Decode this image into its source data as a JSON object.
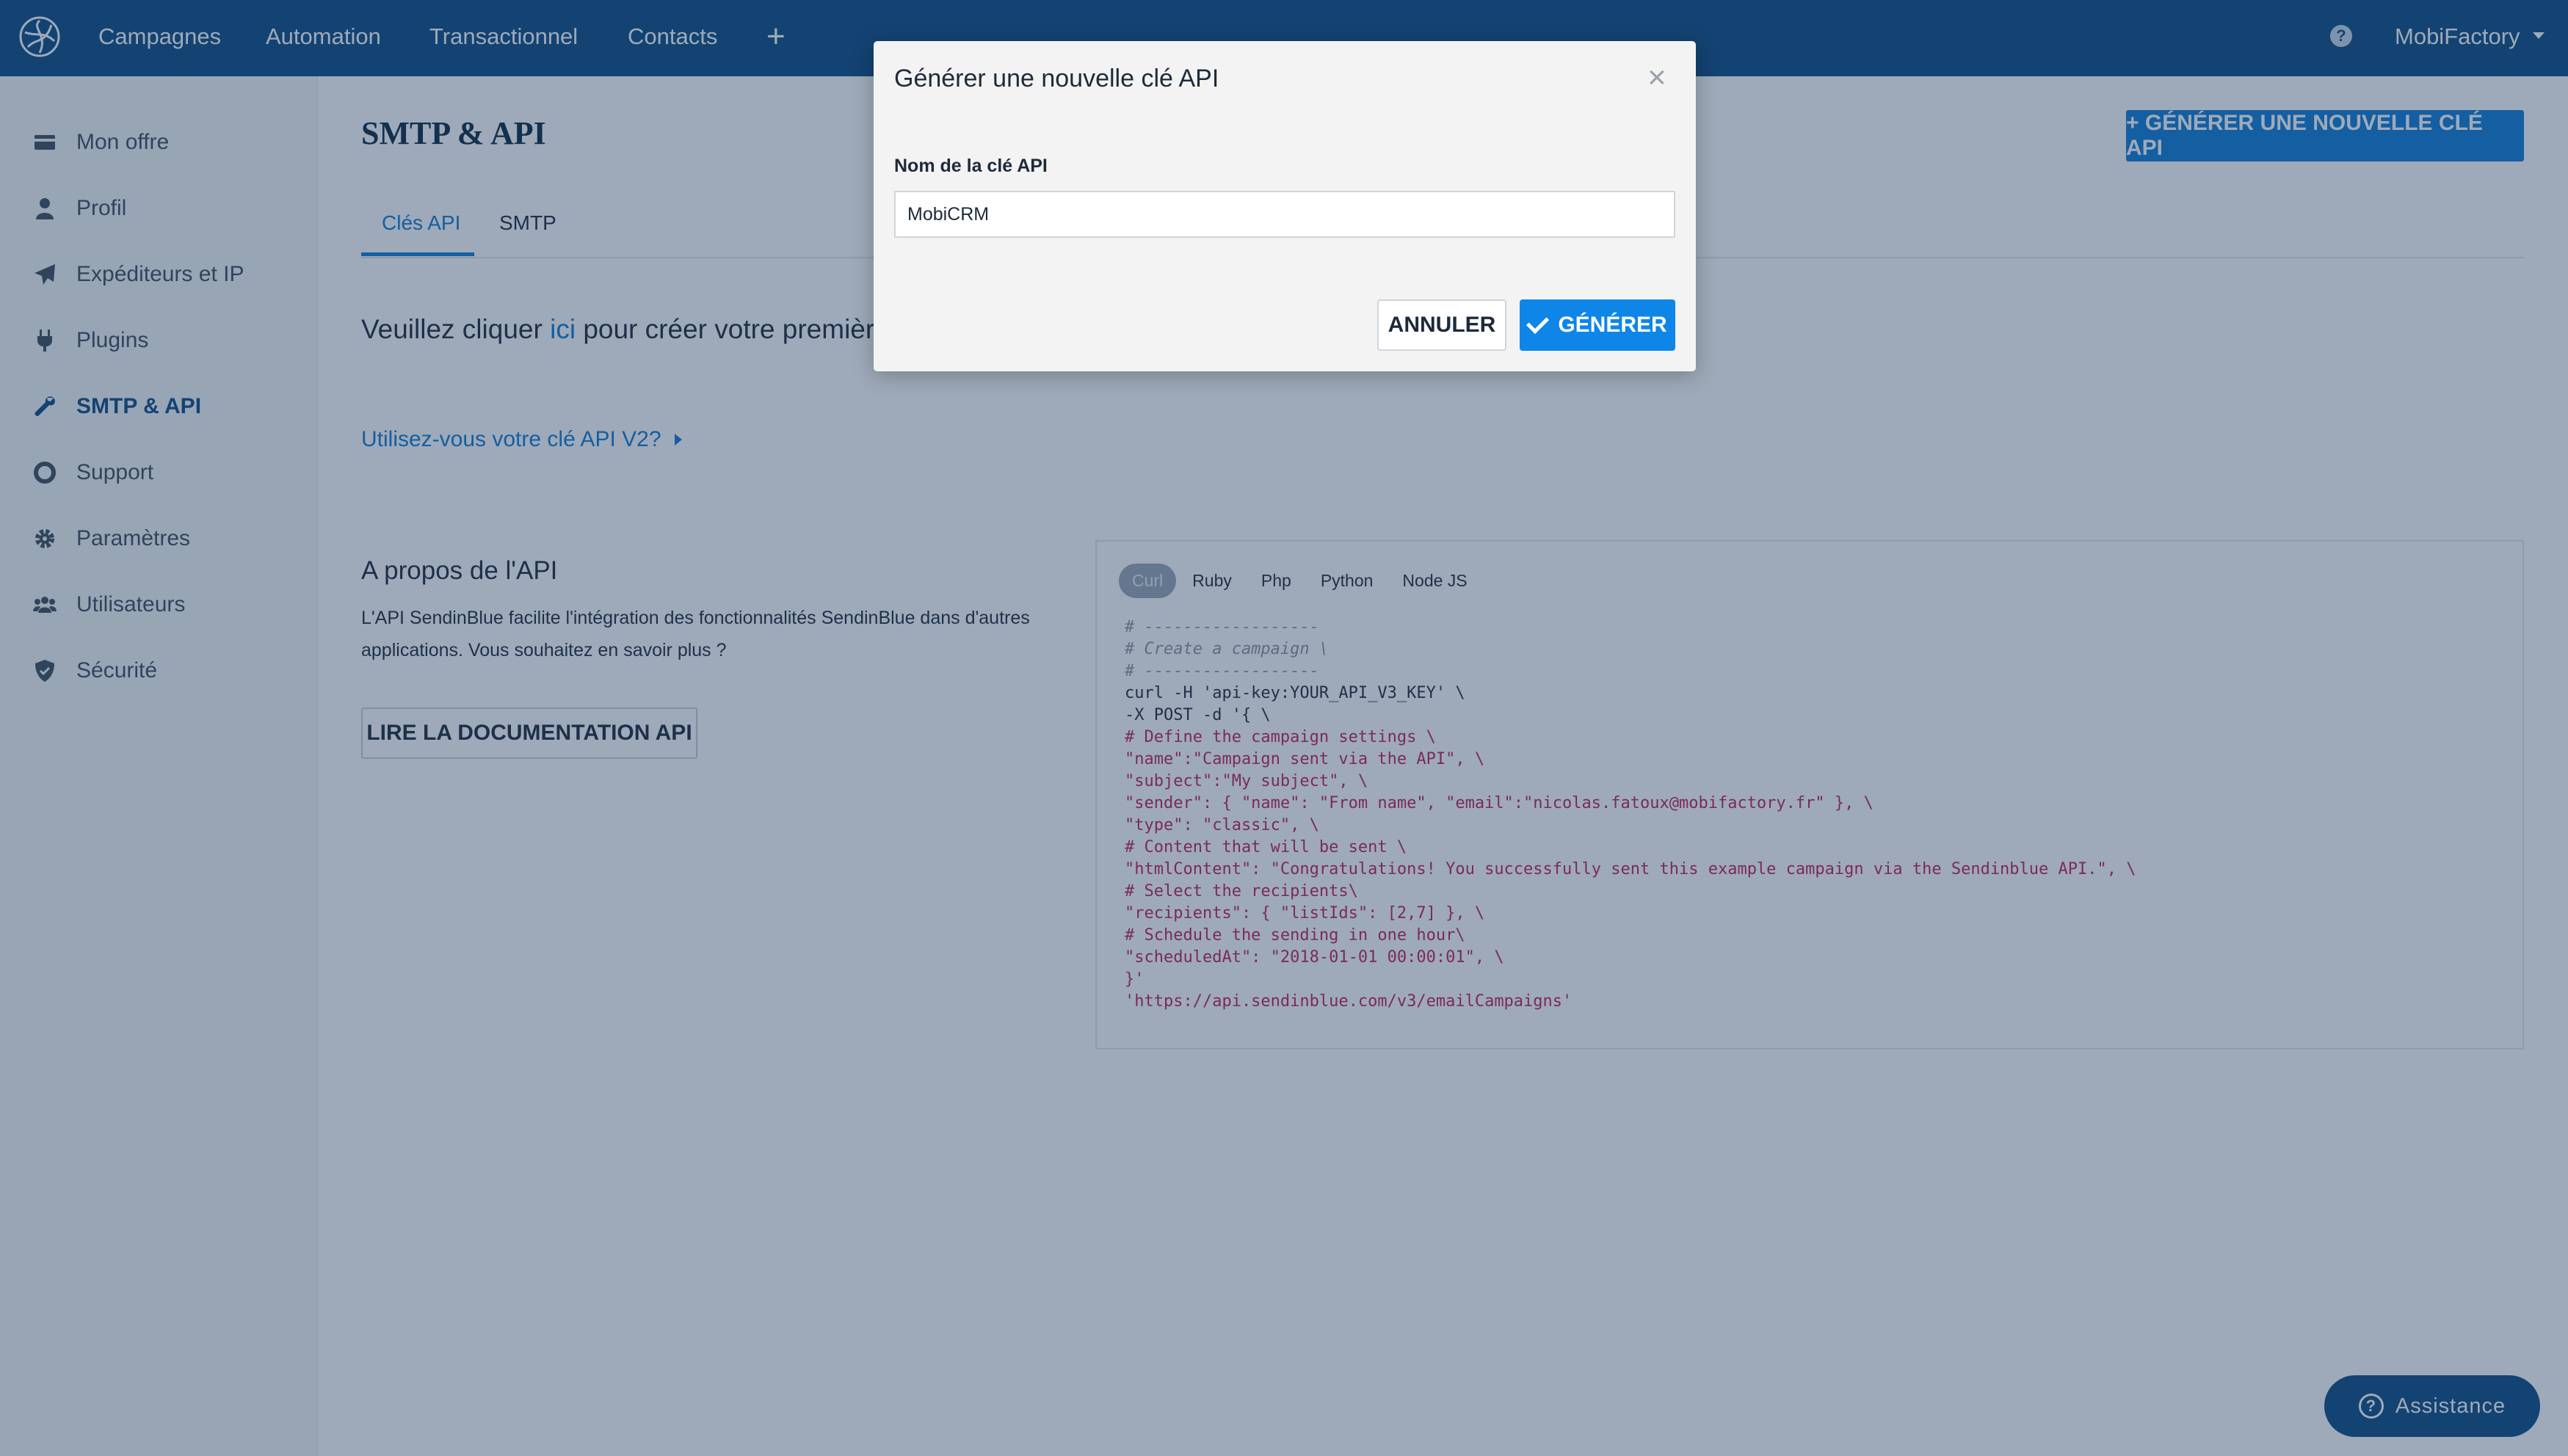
{
  "nav": {
    "items": [
      "Campagnes",
      "Automation",
      "Transactionnel",
      "Contacts"
    ],
    "plus": "+",
    "help_icon": "question-circle-icon",
    "account": "MobiFactory",
    "brand_color": "#0b4a82"
  },
  "sidebar": {
    "items": [
      {
        "label": "Mon offre",
        "icon": "credit-card-icon"
      },
      {
        "label": "Profil",
        "icon": "user-icon"
      },
      {
        "label": "Expéditeurs et IP",
        "icon": "paper-plane-icon"
      },
      {
        "label": "Plugins",
        "icon": "plug-icon"
      },
      {
        "label": "SMTP & API",
        "icon": "wrench-icon",
        "active": true
      },
      {
        "label": "Support",
        "icon": "life-ring-icon"
      },
      {
        "label": "Paramètres",
        "icon": "gear-icon"
      },
      {
        "label": "Utilisateurs",
        "icon": "users-icon"
      },
      {
        "label": "Sécurité",
        "icon": "shield-icon"
      }
    ]
  },
  "main": {
    "title": "SMTP & API",
    "generate_button": "+ GÉNÉRER UNE NOUVELLE CLÉ API",
    "tabs": [
      "Clés API",
      "SMTP"
    ],
    "active_tab": "Clés API",
    "intro_before": "Veuillez cliquer ",
    "intro_link": "ici",
    "intro_after": " pour créer votre première",
    "v2_link": "Utilisez-vous votre clé API V2?",
    "about_title": "A propos de l'API",
    "about_text": "L'API SendinBlue facilite l'intégration des fonctionnalités SendinBlue dans d'autres applications. Vous souhaitez en savoir plus ?",
    "doc_button": "LIRE LA DOCUMENTATION API",
    "accent_color": "#0d7ad6"
  },
  "code_panel": {
    "tabs": [
      "Curl",
      "Ruby",
      "Php",
      "Python",
      "Node JS"
    ],
    "active_tab": "Curl",
    "lines": [
      "# ------------------",
      "# Create a campaign \\",
      "# ------------------",
      "curl -H 'api-key:YOUR_API_V3_KEY' \\",
      "-X POST -d '{ \\",
      "# Define the campaign settings \\",
      "\"name\":\"Campaign sent via the API\", \\",
      "\"subject\":\"My subject\", \\",
      "\"sender\": { \"name\": \"From name\", \"email\":\"nicolas.fatoux@mobifactory.fr\" }, \\",
      "\"type\": \"classic\", \\",
      "# Content that will be sent \\",
      "\"htmlContent\": \"Congratulations! You successfully sent this example campaign via the Sendinblue API.\", \\",
      "# Select the recipients\\",
      "\"recipients\": { \"listIds\": [2,7] }, \\",
      "# Schedule the sending in one hour\\",
      "\"scheduledAt\": \"2018-01-01 00:00:01\", \\",
      "}'",
      "'https://api.sendinblue.com/v3/emailCampaigns'"
    ]
  },
  "assistance": {
    "label": "Assistance",
    "icon": "question-circle-icon"
  },
  "modal": {
    "title": "Générer une nouvelle clé API",
    "close": "×",
    "field_label": "Nom de la clé API",
    "field_value": "MobiCRM",
    "cancel": "ANNULER",
    "generate": "GÉNÉRER",
    "generate_color": "#0d86e8"
  }
}
